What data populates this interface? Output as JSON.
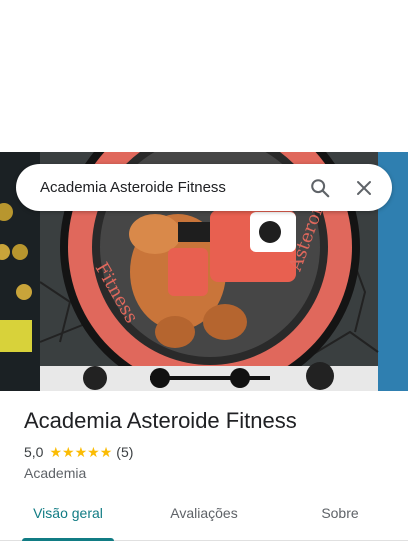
{
  "search": {
    "query": "Academia Asteroide Fitness"
  },
  "place": {
    "name": "Academia Asteroide Fitness",
    "rating": "5,0",
    "stars": 5,
    "review_count": "(5)",
    "category": "Academia"
  },
  "tabs": [
    {
      "label": "Visão geral",
      "active": true
    },
    {
      "label": "Avaliações",
      "active": false
    },
    {
      "label": "Sobre",
      "active": false
    }
  ],
  "icons": {
    "search": "search-icon",
    "close": "close-icon"
  },
  "colors": {
    "accent": "#117c84",
    "star": "#fbbc04",
    "text_primary": "#202124",
    "text_secondary": "#5f6368"
  }
}
